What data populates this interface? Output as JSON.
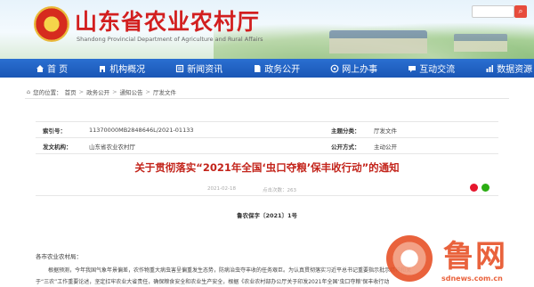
{
  "header": {
    "site_title": "山东省农业农村厅",
    "site_subtitle": "Shandong Provincial Department of Agriculture and Rural Affairs"
  },
  "nav": {
    "items": [
      {
        "label": "首 页",
        "icon": "home-icon"
      },
      {
        "label": "机构概况",
        "icon": "building-icon"
      },
      {
        "label": "新闻资讯",
        "icon": "news-icon"
      },
      {
        "label": "政务公开",
        "icon": "document-icon"
      },
      {
        "label": "网上办事",
        "icon": "service-icon"
      },
      {
        "label": "互动交流",
        "icon": "chat-icon"
      },
      {
        "label": "数据资源",
        "icon": "data-icon"
      }
    ]
  },
  "breadcrumb": {
    "prefix": "您的位置：",
    "items": [
      "首页",
      "政务公开",
      "通知公告",
      "厅发文件"
    ]
  },
  "info": {
    "index_label": "索引号：",
    "index_value": "11370000MB2848646L/2021-01133",
    "category_label": "主题分类：",
    "category_value": "厅发文件",
    "issuer_label": "发文机构：",
    "issuer_value": "山东省农业农村厅",
    "open_label": "公开方式：",
    "open_value": "主动公开"
  },
  "article": {
    "title": "关于贯彻落实“2021年全国‘虫口夺粮’保丰收行动”的通知",
    "date": "2021-02-18",
    "reads_label": "点击次数：",
    "reads": "263",
    "doc_number": "鲁农保字〔2021〕1号",
    "salutation": "各市农业农村局：",
    "p1": "根据预测，今年我国气象年景偏差，农作物重大病虫害呈偏重发生态势，防病治虫夺丰收的任务艰巨。为认真贯彻落实习近平总书记重要指示批示精神和关",
    "p2": "于“三农”工作重要论述，坚定扛牢农业大省责任，确保粮食安全和农业生产安全，根据《农业农村部办公厅关于印发2021年全国‘虫口夺粮’保丰收行动"
  },
  "watermark": {
    "text": "鲁网",
    "url": "sdnews.com.cn"
  },
  "colors": {
    "title_red": "#d21f1f",
    "nav_blue": "#1f62c4",
    "article_title": "#c3241b",
    "watermark": "#e8552c"
  }
}
